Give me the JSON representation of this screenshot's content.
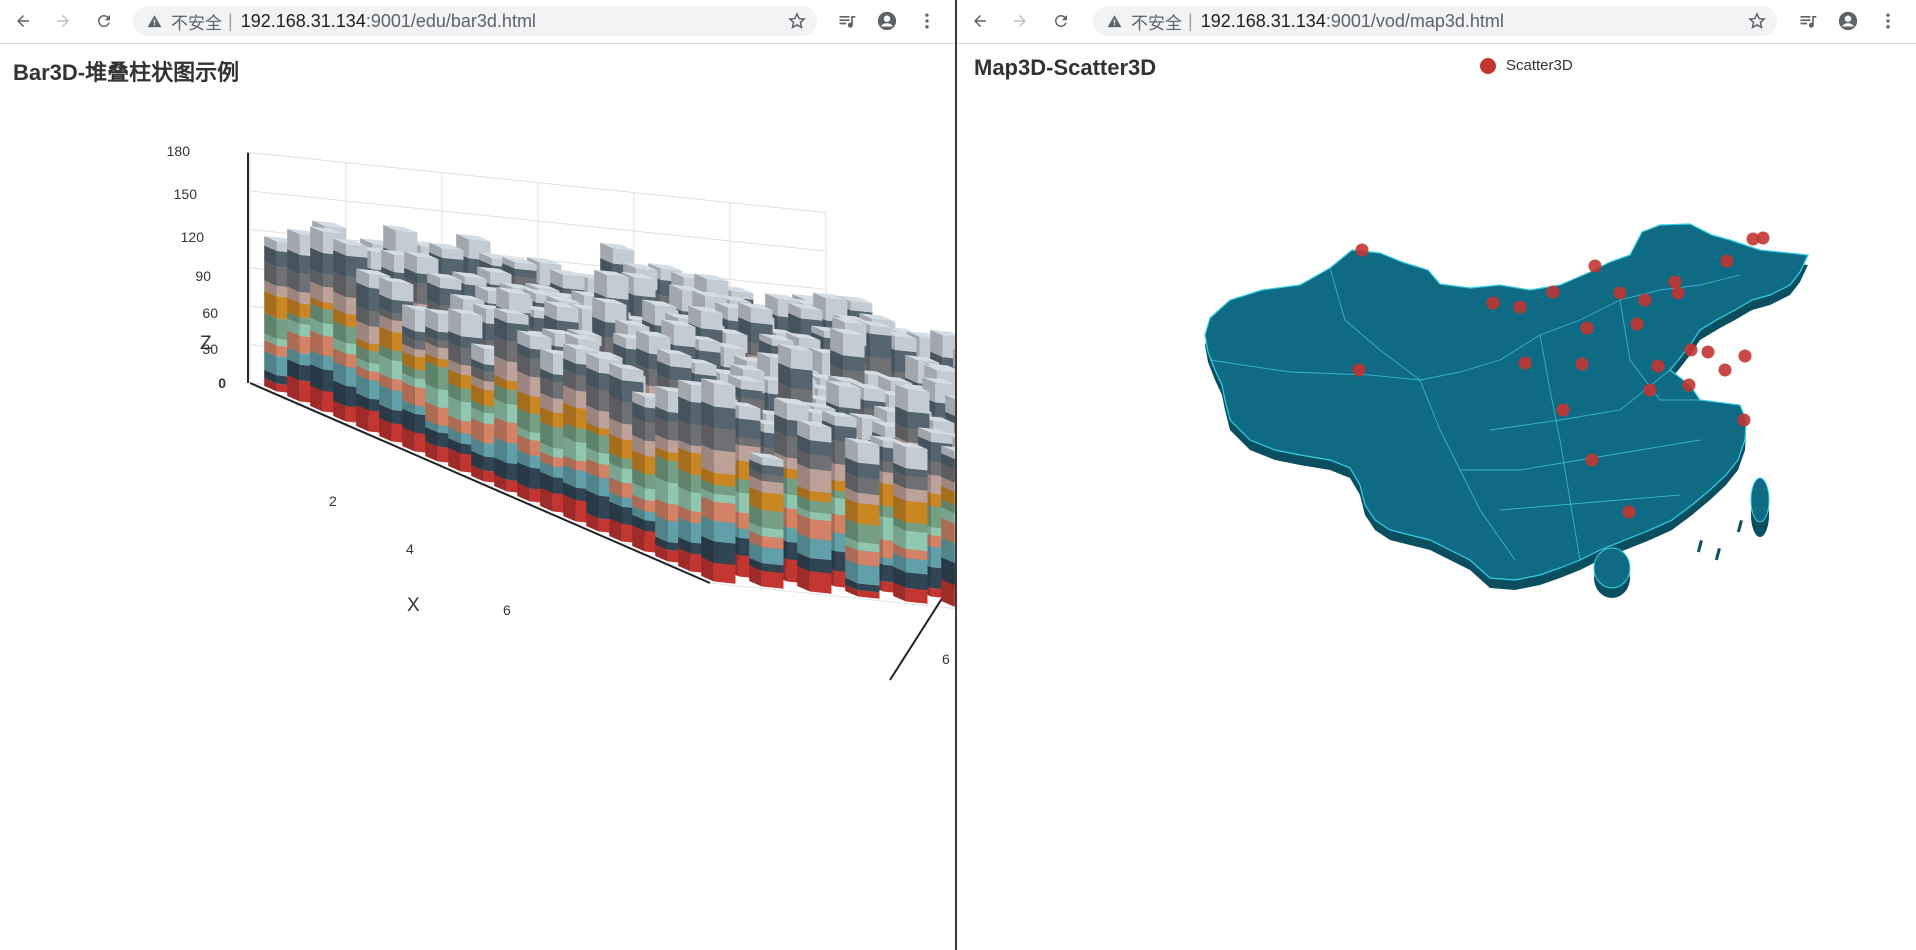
{
  "left": {
    "url_insecure": "不安全",
    "url_host": "192.168.31.134",
    "url_path": ":9001/edu/bar3d.html",
    "page_title": "Bar3D-堆叠柱状图示例",
    "chart_data": {
      "type": "bar3d-stacked",
      "title": "Bar3D-堆叠柱状图示例",
      "xlabel": "X",
      "zlabel": "Z",
      "z_ticks": [
        "0",
        "30",
        "60",
        "90",
        "120",
        "150",
        "180"
      ],
      "x_ticks": [
        "2",
        "4",
        "6"
      ],
      "y_ticks": [
        "6"
      ],
      "zlim": [
        0,
        180
      ],
      "grid": true,
      "colors": [
        "#c23531",
        "#2f4554",
        "#61a0a8",
        "#d48265",
        "#91c7ae",
        "#749f83",
        "#ca8622",
        "#bda29a",
        "#6e7074",
        "#546570",
        "#c4ccd3"
      ]
    }
  },
  "right": {
    "url_insecure": "不安全",
    "url_host": "192.168.31.134",
    "url_path": ":9001/vod/map3d.html",
    "page_title": "Map3D-Scatter3D",
    "legend_label": "Scatter3D",
    "chart_data": {
      "type": "map3d-scatter",
      "title": "Map3D-Scatter3D",
      "series": [
        {
          "name": "Scatter3D",
          "color": "#c23531"
        }
      ],
      "map_color": "#0f6b83",
      "map_edge_color": "#34d1e6"
    }
  },
  "icons": {
    "back": "back-arrow-icon",
    "forward": "forward-arrow-icon",
    "reload": "reload-icon",
    "warning": "warning-triangle-icon",
    "bookmark": "star-icon",
    "media": "media-queue-icon",
    "account": "account-icon",
    "menu": "more-vert-icon"
  }
}
